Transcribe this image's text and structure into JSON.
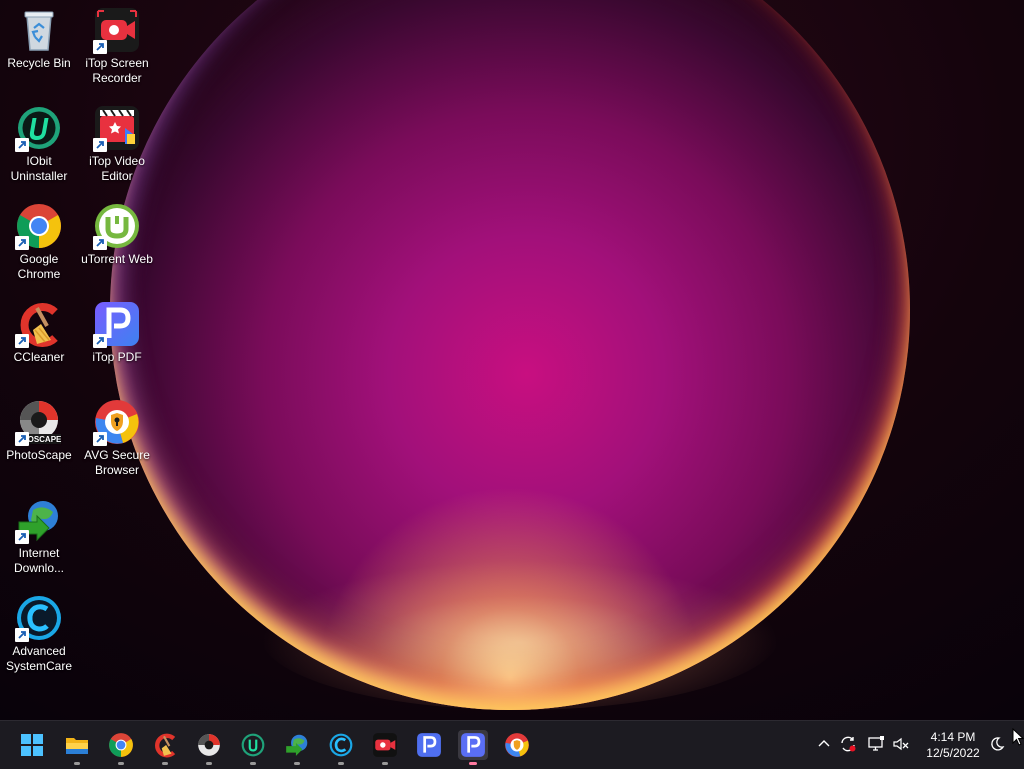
{
  "desktop": {
    "icons": [
      {
        "label": "Recycle Bin",
        "icon": "recycle-bin-icon"
      },
      {
        "label": "iTop Screen\nRecorder",
        "icon": "itop-screen-recorder-icon"
      },
      {
        "label": "IObit\nUninstaller",
        "icon": "iobit-uninstaller-icon"
      },
      {
        "label": "iTop Video\nEditor",
        "icon": "itop-video-editor-icon"
      },
      {
        "label": "Google\nChrome",
        "icon": "chrome-icon"
      },
      {
        "label": "uTorrent Web",
        "icon": "utorrent-icon"
      },
      {
        "label": "CCleaner",
        "icon": "ccleaner-icon"
      },
      {
        "label": "iTop PDF",
        "icon": "itop-pdf-icon"
      },
      {
        "label": "PhotoScape",
        "icon": "photoscape-icon"
      },
      {
        "label": "AVG Secure\nBrowser",
        "icon": "avg-browser-icon"
      },
      {
        "label": "Internet\nDownlo...",
        "icon": "internet-download-manager-icon"
      },
      {
        "label": "Advanced\nSystemCare",
        "icon": "advanced-systemcare-icon"
      }
    ],
    "photoscape_badge_text": "OTOSCAPE"
  },
  "taskbar": {
    "pinned": [
      "start-icon",
      "file-explorer-icon",
      "chrome-icon",
      "ccleaner-icon",
      "photoscape-icon",
      "iobit-uninstaller-icon",
      "internet-download-manager-icon",
      "advanced-systemcare-icon",
      "itop-screen-recorder-icon",
      "itop-pdf-icon",
      "itop-pdf-icon",
      "avg-browser-icon"
    ],
    "tray_icons": [
      "chevron-up-icon",
      "sync-icon",
      "display-icon",
      "volume-muted-icon",
      "moon-icon"
    ],
    "clock": {
      "time": "4:14 PM",
      "date": "12/5/2022"
    }
  },
  "colors": {
    "taskbar_bg": "#1c1b21",
    "itop_red": "#e8313f",
    "iobit_green": "#1fa37a",
    "chrome_red": "#db4437",
    "chrome_yellow": "#f4c20d",
    "chrome_green": "#0f9d58",
    "chrome_blue": "#4285f4",
    "itop_pdf_blue": "#4f6ff0",
    "utorrent_green": "#76b83f",
    "asc_blue": "#1aa7e6"
  }
}
